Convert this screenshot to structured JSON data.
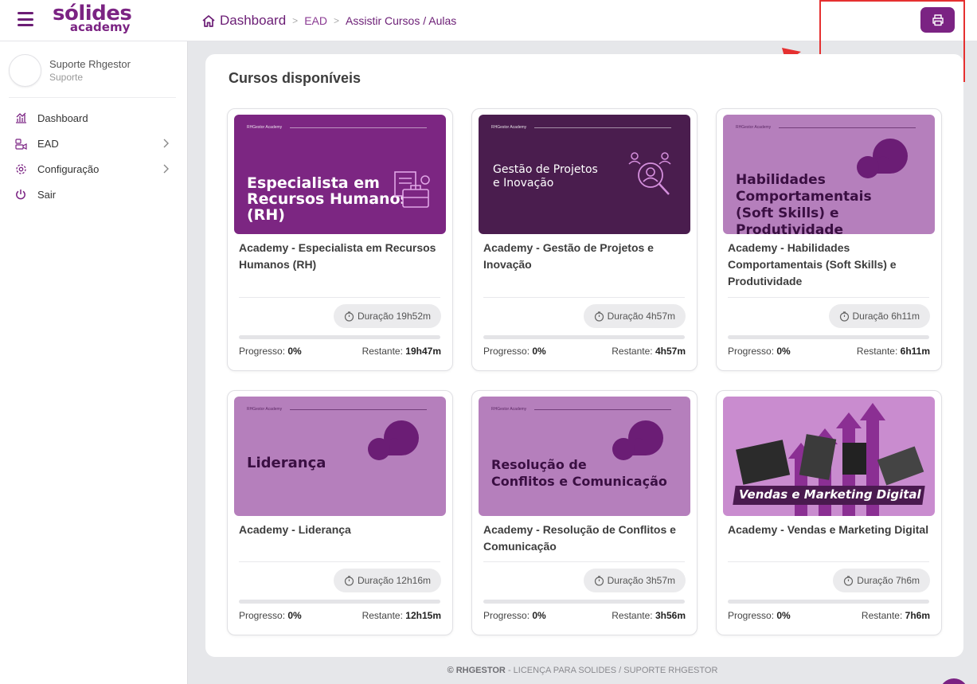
{
  "header": {
    "logo_main": "sólides",
    "logo_sub": "academy",
    "breadcrumb": {
      "home": "Dashboard",
      "section": "EAD",
      "current": "Assistir Cursos / Aulas"
    }
  },
  "user": {
    "name": "Suporte Rhgestor",
    "role": "Suporte"
  },
  "sidebar": {
    "items": [
      {
        "label": "Dashboard"
      },
      {
        "label": "EAD"
      },
      {
        "label": "Configuração"
      },
      {
        "label": "Sair"
      }
    ]
  },
  "main": {
    "title": "Cursos disponíveis"
  },
  "courses": [
    {
      "thumb_text": "Especialista em Recursos Humanos (RH)",
      "thumb_l1": "Especialista em",
      "thumb_l2": "Recursos Humanos",
      "thumb_l3": "(RH)",
      "title": "Academy - Especialista em Recursos Humanos (RH)",
      "duration": "Duração 19h52m",
      "progress_label": "Progresso:",
      "progress": "0%",
      "remaining_label": "Restante:",
      "remaining": "19h47m"
    },
    {
      "thumb_l1": "Gestão de Projetos",
      "thumb_l2": "e Inovação",
      "title": "Academy - Gestão de Projetos e Inovação",
      "duration": "Duração 4h57m",
      "progress_label": "Progresso:",
      "progress": "0%",
      "remaining_label": "Restante:",
      "remaining": "4h57m"
    },
    {
      "thumb_l1": "Habilidades",
      "thumb_l2": "Comportamentais",
      "thumb_l3": "(Soft Skills) e Produtividade",
      "title": "Academy - Habilidades Comportamentais (Soft Skills) e Produtividade",
      "duration": "Duração 6h11m",
      "progress_label": "Progresso:",
      "progress": "0%",
      "remaining_label": "Restante:",
      "remaining": "6h11m"
    },
    {
      "thumb_l1": "Liderança",
      "title": "Academy - Liderança",
      "duration": "Duração 12h16m",
      "progress_label": "Progresso:",
      "progress": "0%",
      "remaining_label": "Restante:",
      "remaining": "12h15m"
    },
    {
      "thumb_l1": "Resolução de",
      "thumb_l2": "Conflitos e Comunicação",
      "title": "Academy - Resolução de Conflitos e Comunicação",
      "duration": "Duração 3h57m",
      "progress_label": "Progresso:",
      "progress": "0%",
      "remaining_label": "Restante:",
      "remaining": "3h56m"
    },
    {
      "thumb_l1": "Vendas e Marketing Digital",
      "title": "Academy - Vendas e Marketing Digital",
      "duration": "Duração 7h6m",
      "progress_label": "Progresso:",
      "progress": "0%",
      "remaining_label": "Restante:",
      "remaining": "7h6m"
    }
  ],
  "thumb_brand": "RHGestor Academy",
  "footer": {
    "brand": "© RHGESTOR",
    "text": " - LICENÇA PARA SOLIDES / SUPORTE RHGESTOR"
  },
  "colors": {
    "brand": "#7b2383",
    "annotation": "#e53030"
  },
  "icons": [
    "menu-icon",
    "home-icon",
    "printer-icon",
    "chart-icon",
    "ead-icon",
    "gear-icon",
    "power-icon",
    "chevron-right-icon",
    "timer-icon"
  ]
}
